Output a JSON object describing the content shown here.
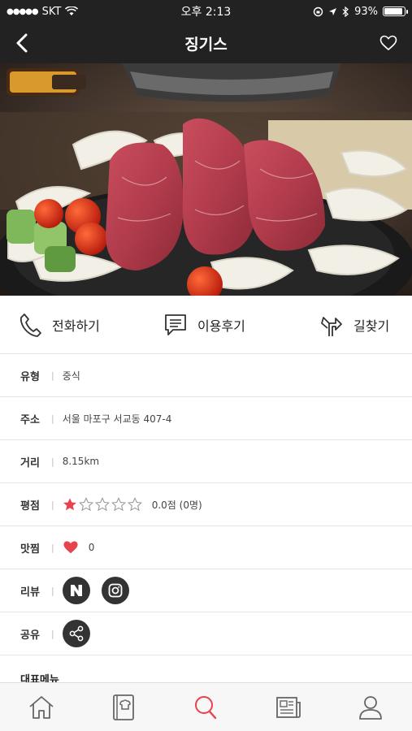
{
  "status_bar": {
    "carrier": "SKT",
    "time": "오후 2:13",
    "battery": "93%",
    "battery_level": 0.93
  },
  "header": {
    "title": "징기스"
  },
  "actions": [
    {
      "label": "전화하기",
      "icon": "phone-icon"
    },
    {
      "label": "이용후기",
      "icon": "review-icon"
    },
    {
      "label": "길찾기",
      "icon": "directions-icon"
    }
  ],
  "info": {
    "type": {
      "label": "유형",
      "value": "중식"
    },
    "address": {
      "label": "주소",
      "value": "서울 마포구 서교동 407-4"
    },
    "distance": {
      "label": "거리",
      "value": "8.15km"
    },
    "rating": {
      "label": "평점",
      "value": "0.0점 (0명)",
      "stars_filled": 1,
      "stars_total": 5
    },
    "likes": {
      "label": "맛찜",
      "value": "0"
    },
    "review": {
      "label": "리뷰",
      "services": [
        "naver-icon",
        "instagram-icon"
      ]
    },
    "share": {
      "label": "공유"
    }
  },
  "menu_section": {
    "title": "대표메뉴"
  },
  "tabbar": {
    "items": [
      "home-icon",
      "recipe-book-icon",
      "search-icon",
      "news-icon",
      "profile-icon"
    ],
    "active_index": 2
  },
  "colors": {
    "accent": "#e8424e",
    "header_bg": "#222222"
  }
}
